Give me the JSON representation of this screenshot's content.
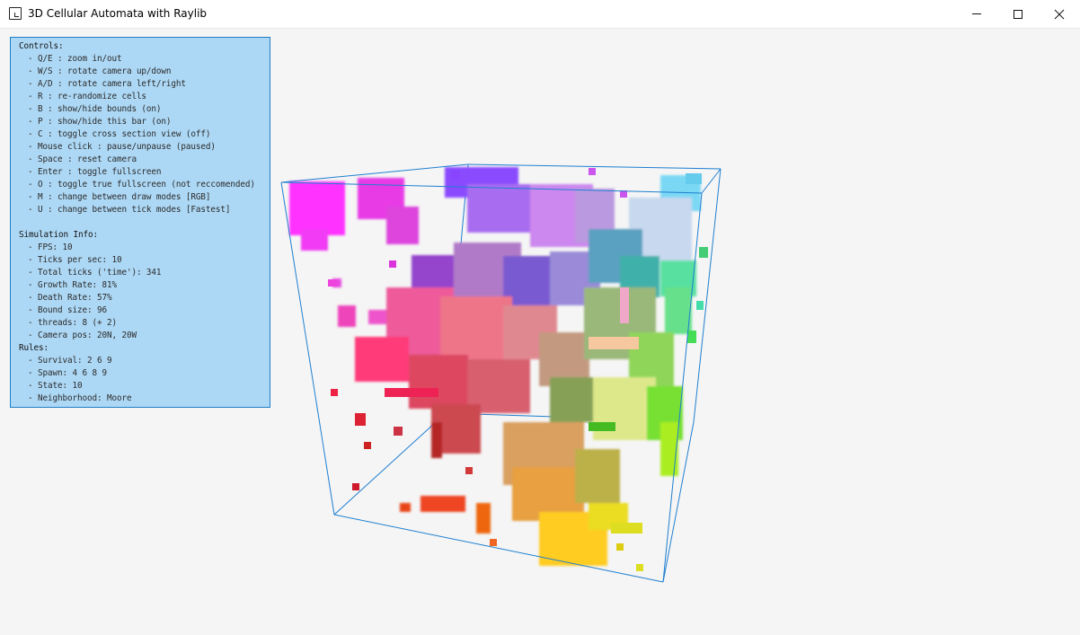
{
  "window": {
    "title": "3D Cellular Automata with Raylib",
    "controls": {
      "minimize": "minimize",
      "maximize": "maximize",
      "close": "close"
    }
  },
  "panel": {
    "controls_heading": "Controls:",
    "controls": [
      "- Q/E : zoom in/out",
      "- W/S : rotate camera up/down",
      "- A/D : rotate camera left/right",
      "- R : re-randomize cells",
      "- B : show/hide bounds (on)",
      "- P : show/hide this bar (on)",
      "- C : toggle cross section view (off)",
      "- Mouse click : pause/unpause (paused)",
      "- Space : reset camera",
      "- Enter : toggle fullscreen",
      "- O : toggle true fullscreen (not reccomended)",
      "- M : change between draw modes [RGB]",
      "- U : change between tick modes [Fastest]"
    ],
    "sim_heading": "Simulation Info:",
    "sim_info": [
      "- FPS: 10",
      "- Ticks per sec: 10",
      "- Total ticks ('time'): 341",
      "- Growth Rate: 81%",
      "- Death Rate: 57%",
      "- Bound size: 96",
      "- threads: 8 (+ 2)",
      "- Camera pos: 20N, 20W"
    ],
    "rules_heading": "Rules:",
    "rules": [
      "- Survival: 2 6 9",
      "- Spawn: 4 6 8 9",
      "- State: 10",
      "- Neighborhood: Moore"
    ]
  },
  "scene": {
    "bounds_color": "#1e7fd0",
    "blob_colors": [
      "#ff33ff",
      "#8844ff",
      "#ff66cc",
      "#ee4466",
      "#66bbee",
      "#55ee55",
      "#eeaa44",
      "#ffcc22",
      "#cc2222",
      "#ee5522",
      "#bbee55",
      "#aa55cc"
    ]
  }
}
